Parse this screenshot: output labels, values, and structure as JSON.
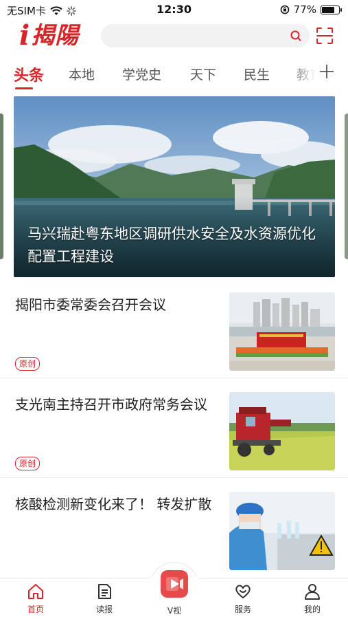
{
  "status_bar": {
    "carrier": "无SIM卡",
    "time": "12:30",
    "battery_percent": "77%",
    "battery_level": 0.77
  },
  "header": {
    "logo_mark": "i",
    "logo_text": "揭陽",
    "search_placeholder": ""
  },
  "tabs": [
    {
      "label": "头条",
      "active": true
    },
    {
      "label": "本地",
      "active": false
    },
    {
      "label": "学党史",
      "active": false
    },
    {
      "label": "天下",
      "active": false
    },
    {
      "label": "民生",
      "active": false
    },
    {
      "label": "教育",
      "active": false
    }
  ],
  "hero": {
    "title": "马兴瑞赴粤东地区调研供水安全及水资源优化配置工程建设"
  },
  "news": [
    {
      "title": "揭阳市委常委会召开会议",
      "badge": "原创"
    },
    {
      "title": "支光南主持召开市政府常务会议",
      "badge": "原创"
    },
    {
      "title": "核酸检测新变化来了！ 转发扩散",
      "badge": ""
    }
  ],
  "bottom_nav": [
    {
      "label": "首页",
      "icon": "home-icon",
      "active": true
    },
    {
      "label": "读报",
      "icon": "newspaper-icon",
      "active": false
    },
    {
      "label": "V视",
      "icon": "video-icon",
      "active": false
    },
    {
      "label": "服务",
      "icon": "heart-smile-icon",
      "active": false
    },
    {
      "label": "我的",
      "icon": "user-icon",
      "active": false
    }
  ],
  "colors": {
    "brand": "#d7262a",
    "video_button": "#e74a4a"
  }
}
